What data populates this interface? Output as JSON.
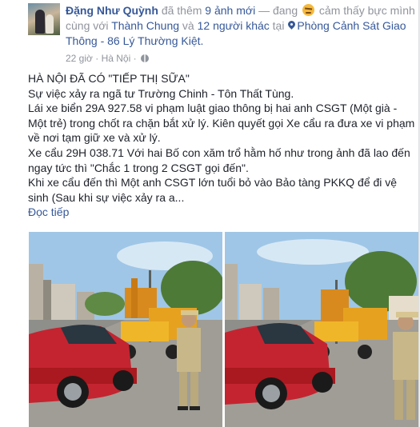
{
  "post": {
    "author": "Đặng Như Quỳnh",
    "added_text": "đã thêm",
    "photos_added": "9 ảnh mới",
    "feeling_prefix": "— đang",
    "feeling": "cảm thấy bực mình",
    "with_text": "cùng với",
    "tagged_friend": "Thành Chung",
    "and_text": "và",
    "others": "12 người khác",
    "at_text": "tại",
    "location": "Phòng Cảnh Sát Giao Thông - 86 Lý Thường Kiệt.",
    "time": "22 giờ",
    "separator": "·",
    "city": "Hà Nội",
    "privacy_icon": "globe-icon",
    "body": [
      "HÀ NỘI ĐÃ CÓ \"TIẾP THỊ SỮA\"",
      "Sự việc xảy ra ngã tư Trường Chinh - Tôn Thất Tùng.",
      "Lái xe biển 29A 927.58 vi phạm luật giao thông bị hai anh CSGT (Một già - Một trẻ) trong chốt ra chặn bắt xử lý. Kiên quyết gọi Xe cẩu ra đưa xe vi phạm về nơi tạm giữ xe và xử lý.",
      "Xe cẩu 29H 038.71 Với hai Bố con xăm trổ hằm hố như trong ảnh đã lao đến ngay tức thì \"Chắc 1 trong 2 CSGT gọi đến\".",
      "Khi xe cẩu đến thì Một anh CSGT lớn tuổi bỏ vào Bảo tàng PKKQ để đi vệ sinh (Sau khi sự việc xảy ra a..."
    ],
    "see_more": "Đọc tiếp",
    "colors": {
      "link": "#365899",
      "meta": "#90949c",
      "text": "#1d2129"
    }
  }
}
